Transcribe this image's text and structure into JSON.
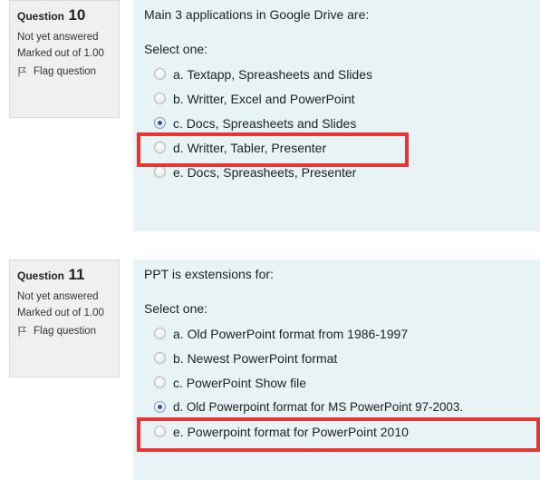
{
  "questions": [
    {
      "label": "Question",
      "number": "10",
      "state": "Not yet answered",
      "grade": "Marked out of 1.00",
      "flag_label": "Flag question",
      "text": "Main 3 applications in Google Drive are:",
      "prompt": "Select one:",
      "options": [
        {
          "label": "a. Textapp, Spreasheets and Slides",
          "selected": false
        },
        {
          "label": "b. Writter, Excel and PowerPoint",
          "selected": false
        },
        {
          "label": "c. Docs, Spreasheets and Slides",
          "selected": true
        },
        {
          "label": "d. Writter, Tabler, Presenter",
          "selected": false
        },
        {
          "label": "e. Docs, Spreasheets, Presenter",
          "selected": false
        }
      ]
    },
    {
      "label": "Question",
      "number": "11",
      "state": "Not yet answered",
      "grade": "Marked out of 1.00",
      "flag_label": "Flag question",
      "text": "PPT is exstensions for:",
      "prompt": "Select one:",
      "options": [
        {
          "label": "a. Old PowerPoint format from 1986-1997",
          "selected": false
        },
        {
          "label": "b. Newest PowerPoint format",
          "selected": false
        },
        {
          "label": "c. PowerPoint Show file",
          "selected": false
        },
        {
          "label": "d. Old Powerpoint format for MS PowerPoint 97-2003.",
          "selected": true
        },
        {
          "label": "e. Powerpoint format for PowerPoint 2010",
          "selected": false
        }
      ]
    }
  ],
  "colors": {
    "highlight": "#e53636",
    "content_bg": "#e7f3f5",
    "info_bg": "#f0f0f0"
  },
  "icons": {
    "flag": "flag-icon"
  }
}
